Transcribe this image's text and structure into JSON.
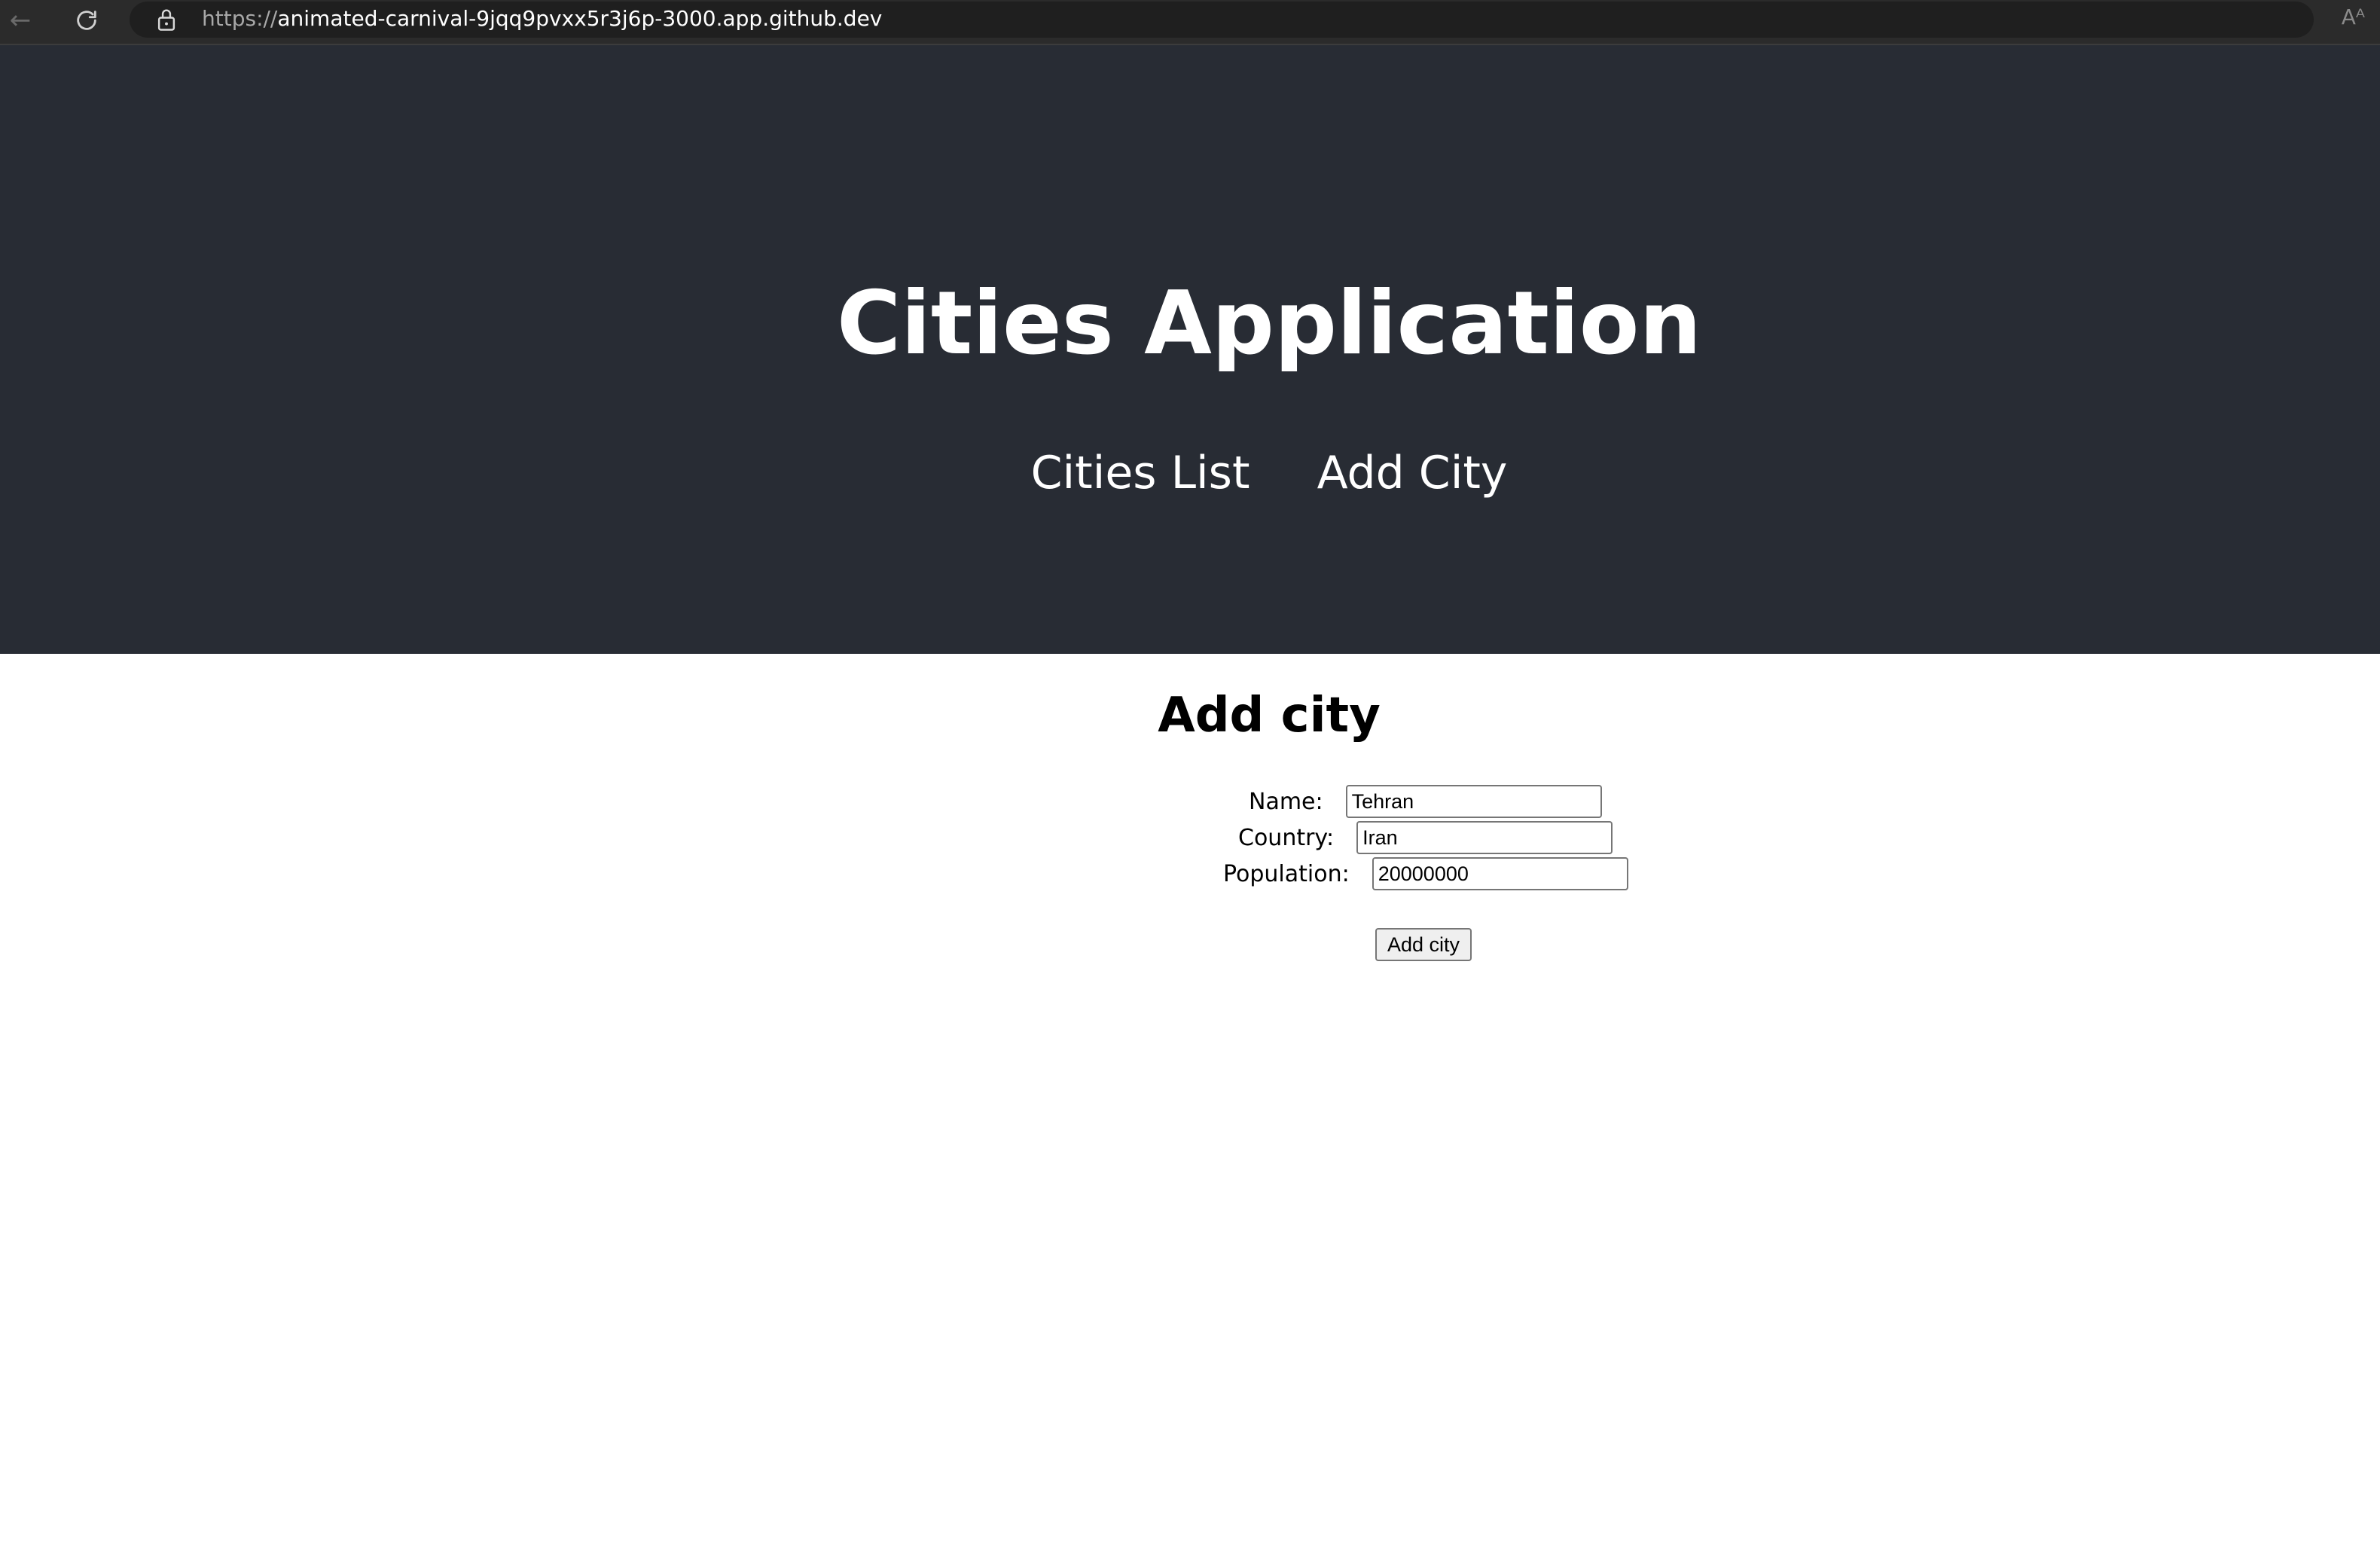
{
  "browser": {
    "url_scheme": "https://",
    "url_host": "animated-carnival-9jqq9pvxx5r3j6p-3000.app.github.dev",
    "reader_label": "Aᴬ",
    "icons": [
      "back-arrow-icon",
      "reload-icon",
      "lock-icon",
      "read-aloud-icon"
    ]
  },
  "header": {
    "title": "Cities Application",
    "nav": {
      "cities_list": "Cities List",
      "add_city": "Add City"
    },
    "background_color": "#282c34"
  },
  "form": {
    "heading": "Add city",
    "fields": {
      "name": {
        "label": "Name:",
        "value": "Tehran"
      },
      "country": {
        "label": "Country:",
        "value": "Iran"
      },
      "population": {
        "label": "Population:",
        "value": "20000000"
      }
    },
    "submit_label": "Add city"
  }
}
